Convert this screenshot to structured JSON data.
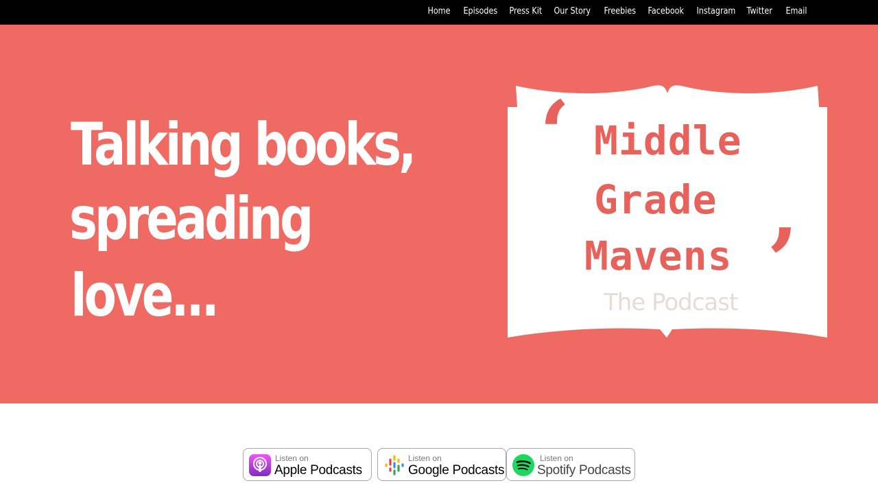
{
  "nav": {
    "items": [
      {
        "label": "Home"
      },
      {
        "label": "Episodes"
      },
      {
        "label": "Press Kit"
      },
      {
        "label": "Our Story"
      },
      {
        "label": "Freebies"
      },
      {
        "label": "Facebook"
      },
      {
        "label": "Instagram"
      },
      {
        "label": "Twitter"
      },
      {
        "label": "Email"
      }
    ]
  },
  "hero": {
    "headline_lines": [
      "Talking books,",
      "spreading",
      "love..."
    ],
    "background_color": "#ee6a62"
  },
  "logo": {
    "line1": "Middle",
    "line2": "Grade",
    "line3": "Mavens",
    "subtitle": "The Podcast",
    "open_quote": "‘",
    "close_quote": "’",
    "text_color": "#e8625c",
    "subtitle_color": "#e6dcd4",
    "icon": "open-book-icon"
  },
  "badges": [
    {
      "small": "Listen on",
      "big": "Apple Podcasts",
      "icon": "apple-podcasts-icon"
    },
    {
      "small": "Listen on",
      "big": "Google Podcasts",
      "icon": "google-podcasts-icon"
    },
    {
      "small": "Listen on",
      "big": "Spotify Podcasts",
      "icon": "spotify-icon"
    }
  ]
}
